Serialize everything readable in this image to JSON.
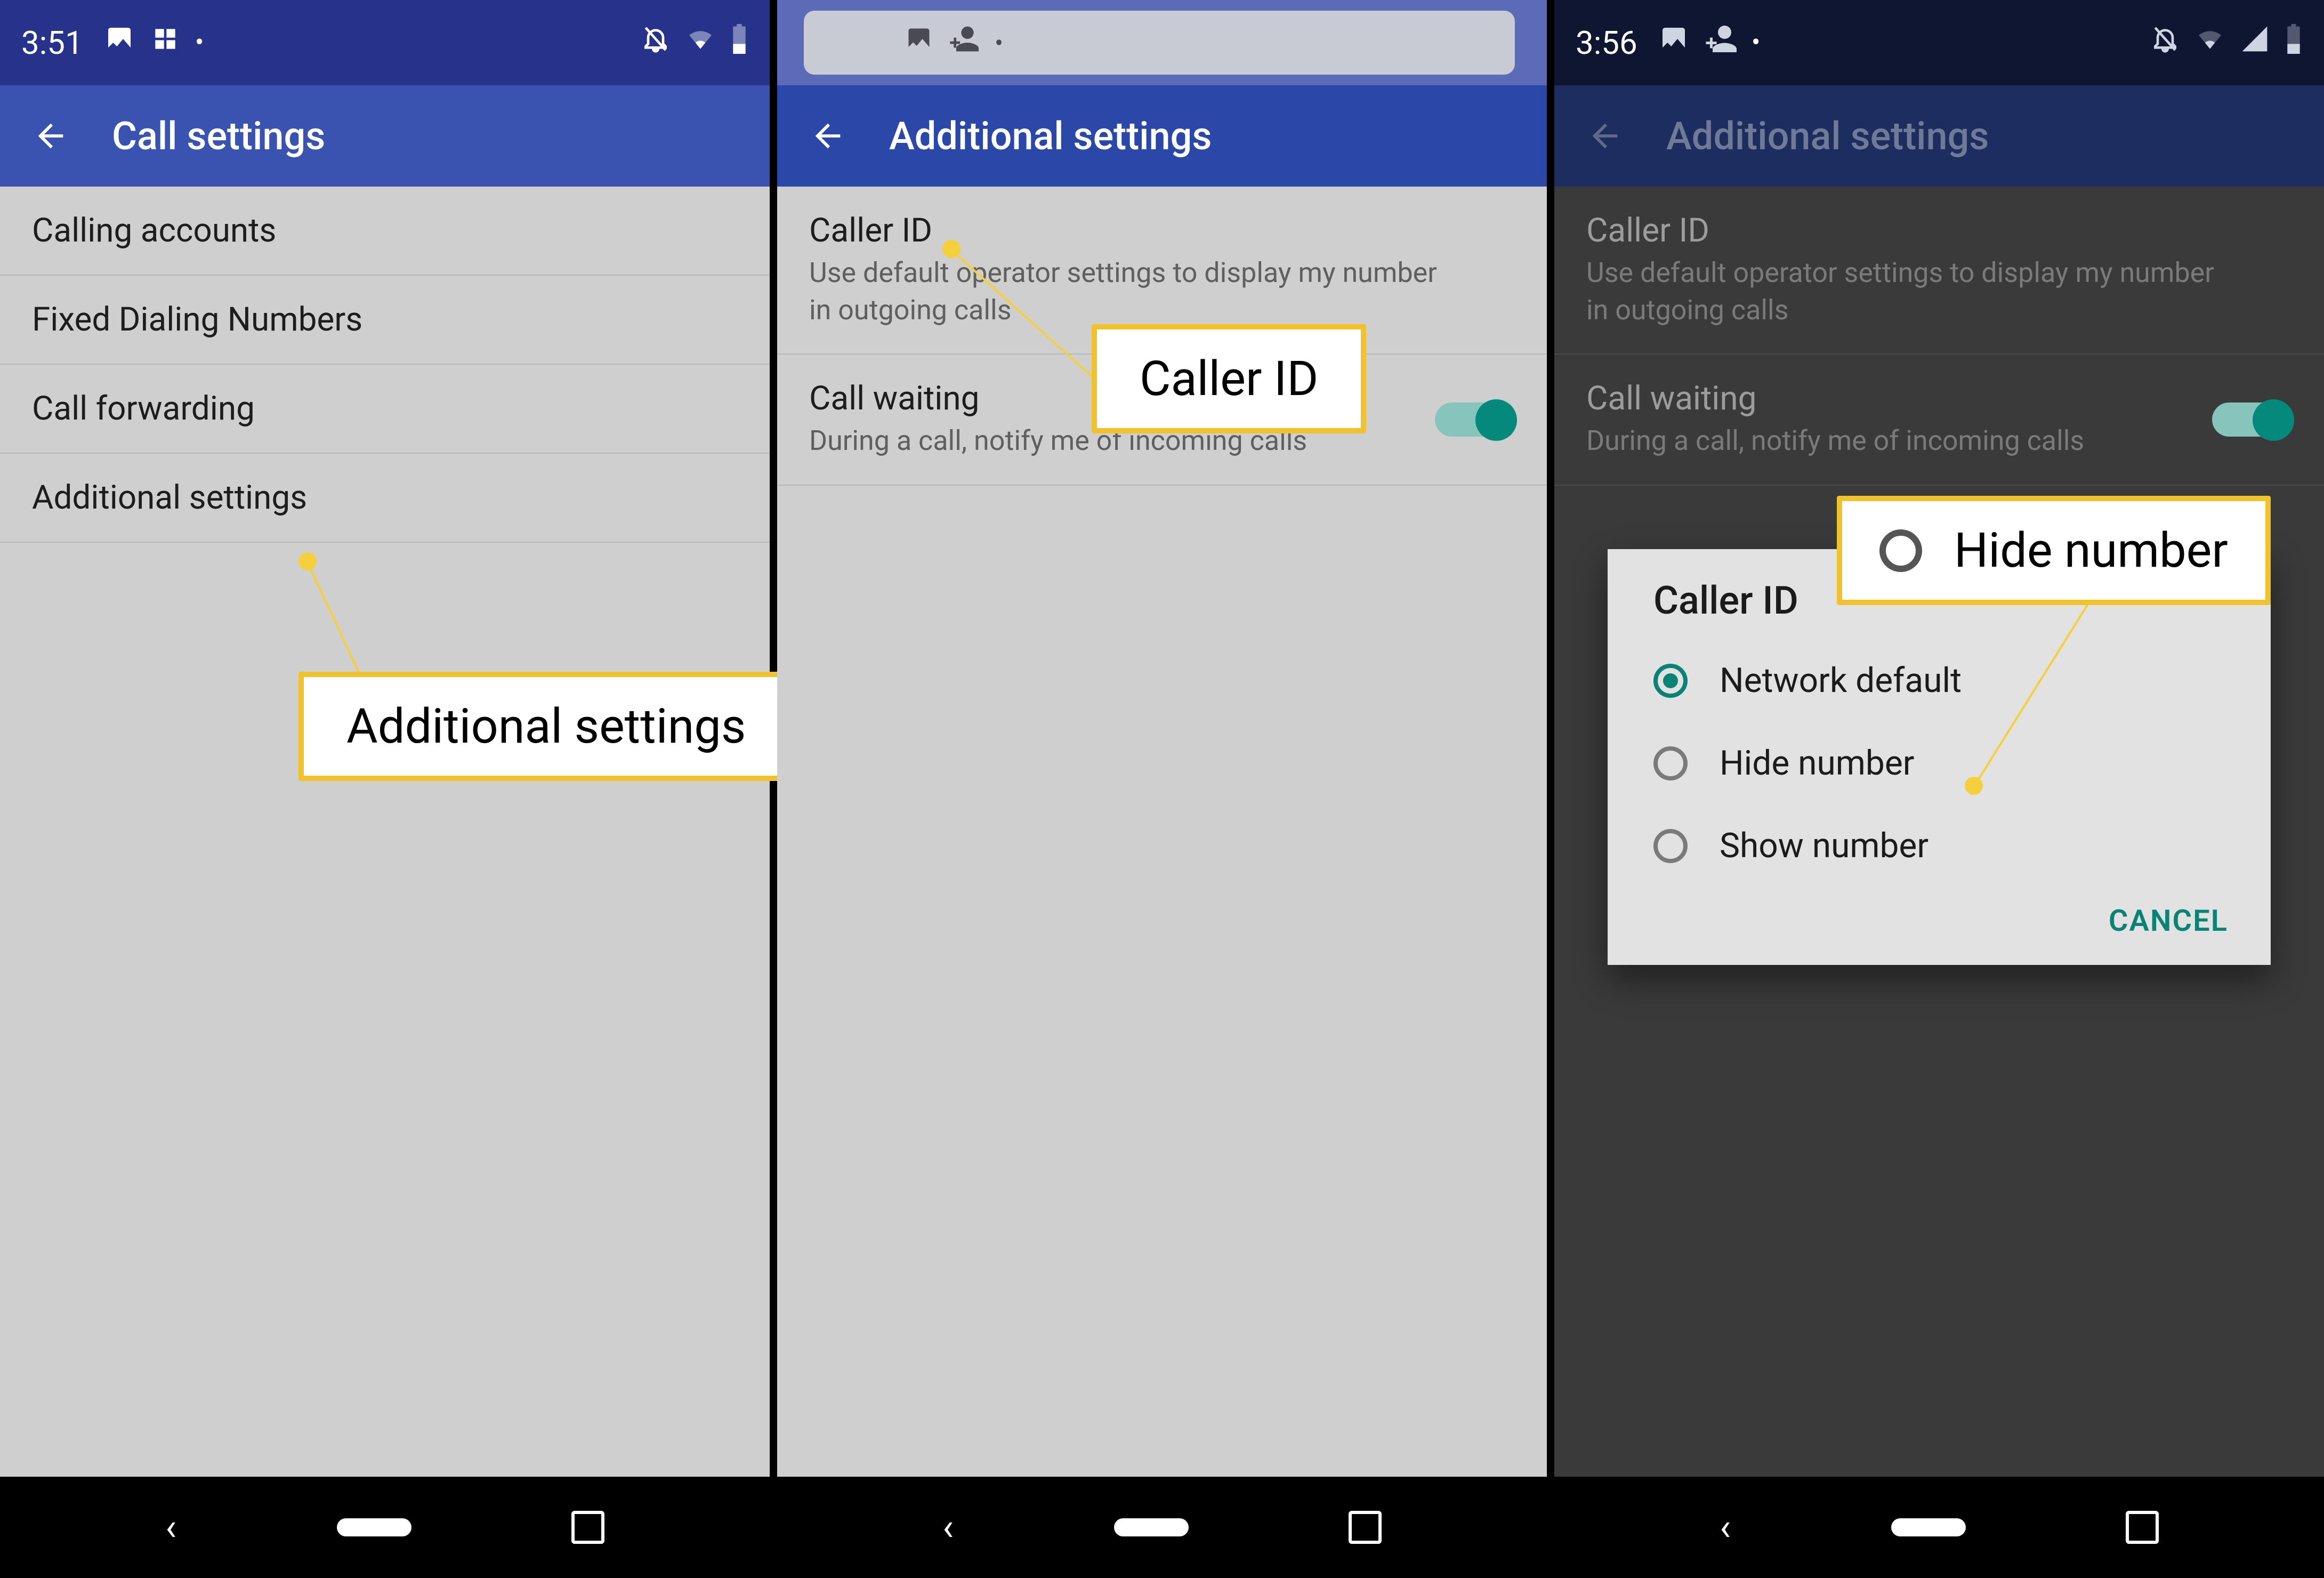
{
  "panel1": {
    "time": "3:51",
    "title": "Call settings",
    "rows": [
      "Calling accounts",
      "Fixed Dialing Numbers",
      "Call forwarding",
      "Additional settings"
    ],
    "callout": "Additional settings"
  },
  "panel2": {
    "title": "Additional settings",
    "caller_id": {
      "title": "Caller ID",
      "sub": "Use default operator settings to display my number in outgoing calls"
    },
    "call_waiting": {
      "title": "Call waiting",
      "sub": "During a call, notify me of incoming calls"
    },
    "callout": "Caller ID"
  },
  "panel3": {
    "time": "3:56",
    "title": "Additional settings",
    "caller_id": {
      "title": "Caller ID",
      "sub": "Use default operator settings to display my number in outgoing calls"
    },
    "call_waiting": {
      "title": "Call waiting",
      "sub": "During a call, notify me of incoming calls"
    },
    "dialog": {
      "title": "Caller ID",
      "options": [
        "Network default",
        "Hide number",
        "Show number"
      ],
      "selected_index": 0,
      "cancel": "CANCEL"
    },
    "callout": "Hide number"
  },
  "colors": {
    "accent": "#04897c",
    "brand": "#2b48a8",
    "highlight": "#efc22e"
  }
}
